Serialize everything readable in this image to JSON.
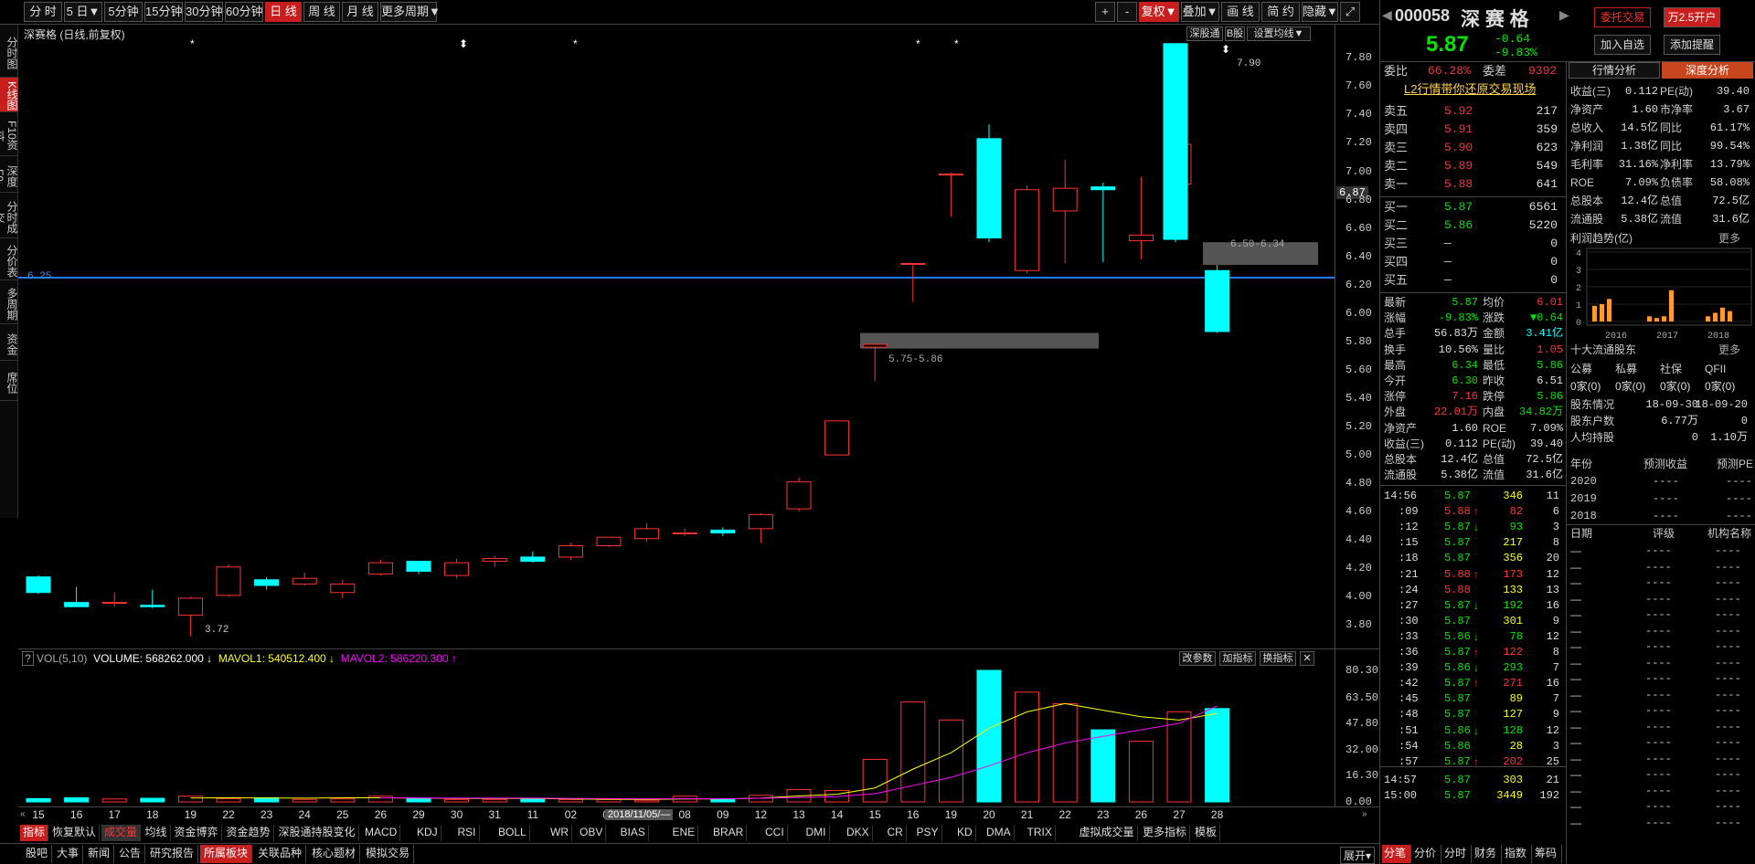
{
  "toolbar": {
    "periods": [
      "分 时",
      "5 日▼",
      "5分钟",
      "15分钟",
      "30分钟",
      "60分钟",
      "日 线",
      "周 线",
      "月 线",
      "更多周期▼"
    ],
    "active_period": "日 线",
    "right_tools": [
      "+",
      "-",
      "复权▼",
      "叠加▼",
      "画 线",
      "简 约",
      "隐藏▼",
      "⤢"
    ]
  },
  "side_tabs": [
    "分时图",
    "K线图",
    "F10资料",
    "深度F9",
    "分时成交",
    "分价表",
    "多周期",
    "资金",
    "席位"
  ],
  "chart": {
    "title": "深赛格 (日线,前复权)",
    "right_buttons": [
      "深股通",
      "B股",
      "设置均线▼"
    ],
    "y_ticks": [
      "7.80",
      "7.60",
      "7.40",
      "7.20",
      "7.00",
      "6.80",
      "6.60",
      "6.40",
      "6.20",
      "6.00",
      "5.80",
      "5.60",
      "5.40",
      "5.20",
      "5.00",
      "4.80",
      "4.60",
      "4.40",
      "4.20",
      "4.00",
      "3.80"
    ],
    "last_price_tag": "6.87",
    "hline_label": "6.25",
    "gap_labels": [
      "6.50-6.34",
      "5.75-5.86"
    ],
    "high_label": "7.90",
    "low_label": "3.72",
    "markers": [
      "*",
      "⬍",
      "*",
      "*",
      "*",
      "⬍"
    ],
    "x_labels": [
      "15",
      "16",
      "17",
      "18",
      "19",
      "22",
      "23",
      "24",
      "25",
      "26",
      "29",
      "30",
      "31",
      "11",
      "02",
      "05",
      "07",
      "08",
      "09",
      "12",
      "13",
      "14",
      "15",
      "16",
      "19",
      "20",
      "21",
      "22",
      "23",
      "26",
      "27",
      "28"
    ],
    "date_tag": "2018/11/05/—"
  },
  "vol": {
    "name": "VOL(5,10)",
    "volume": "VOLUME: 568262.000 ↓",
    "mavol1": "MAVOL1: 540512.400 ↓",
    "mavol2": "MAVOL2: 586220.300 ↑",
    "buttons": [
      "改参数",
      "加指标",
      "换指标",
      "✕"
    ],
    "y_ticks": [
      "80.30",
      "63.50",
      "47.80",
      "32.00",
      "16.30",
      "0.00"
    ]
  },
  "chart_data": {
    "type": "candlestick",
    "ylim": [
      3.7,
      7.95
    ],
    "candles": [
      {
        "x": "15",
        "o": 4.14,
        "h": 4.15,
        "l": 4.02,
        "c": 4.03
      },
      {
        "x": "16",
        "o": 3.96,
        "h": 4.07,
        "l": 3.93,
        "c": 3.93
      },
      {
        "x": "17",
        "o": 3.96,
        "h": 4.03,
        "l": 3.93,
        "c": 3.96
      },
      {
        "x": "18",
        "o": 3.94,
        "h": 4.05,
        "l": 3.92,
        "c": 3.93
      },
      {
        "x": "19",
        "o": 3.87,
        "h": 4.0,
        "l": 3.72,
        "c": 3.99
      },
      {
        "x": "22",
        "o": 4.01,
        "h": 4.23,
        "l": 4.0,
        "c": 4.21
      },
      {
        "x": "23",
        "o": 4.12,
        "h": 4.14,
        "l": 4.05,
        "c": 4.08
      },
      {
        "x": "24",
        "o": 4.09,
        "h": 4.17,
        "l": 4.08,
        "c": 4.13
      },
      {
        "x": "25",
        "o": 4.03,
        "h": 4.12,
        "l": 3.99,
        "c": 4.09
      },
      {
        "x": "26",
        "o": 4.16,
        "h": 4.26,
        "l": 4.15,
        "c": 4.24
      },
      {
        "x": "29",
        "o": 4.25,
        "h": 4.25,
        "l": 4.16,
        "c": 4.18
      },
      {
        "x": "30",
        "o": 4.15,
        "h": 4.27,
        "l": 4.13,
        "c": 4.24
      },
      {
        "x": "31",
        "o": 4.25,
        "h": 4.29,
        "l": 4.21,
        "c": 4.27
      },
      {
        "x": "11",
        "o": 4.28,
        "h": 4.32,
        "l": 4.24,
        "c": 4.25
      },
      {
        "x": "02",
        "o": 4.28,
        "h": 4.38,
        "l": 4.26,
        "c": 4.36
      },
      {
        "x": "05",
        "o": 4.36,
        "h": 4.42,
        "l": 4.35,
        "c": 4.42
      },
      {
        "x": "07",
        "o": 4.41,
        "h": 4.52,
        "l": 4.39,
        "c": 4.48
      },
      {
        "x": "08",
        "o": 4.45,
        "h": 4.48,
        "l": 4.43,
        "c": 4.45
      },
      {
        "x": "09",
        "o": 4.47,
        "h": 4.49,
        "l": 4.43,
        "c": 4.45
      },
      {
        "x": "12",
        "o": 4.48,
        "h": 4.59,
        "l": 4.38,
        "c": 4.58
      },
      {
        "x": "13",
        "o": 4.62,
        "h": 4.84,
        "l": 4.6,
        "c": 4.81
      },
      {
        "x": "14",
        "o": 5.0,
        "h": 5.24,
        "l": 5.0,
        "c": 5.24
      },
      {
        "x": "15",
        "o": 5.76,
        "h": 5.78,
        "l": 5.52,
        "c": 5.78
      },
      {
        "x": "16",
        "o": 6.35,
        "h": 6.35,
        "l": 6.08,
        "c": 6.35
      },
      {
        "x": "19",
        "o": 6.98,
        "h": 6.99,
        "l": 6.68,
        "c": 6.98
      },
      {
        "x": "20",
        "o": 7.23,
        "h": 7.33,
        "l": 6.5,
        "c": 6.53
      },
      {
        "x": "21",
        "o": 6.3,
        "h": 6.9,
        "l": 6.28,
        "c": 6.87
      },
      {
        "x": "22",
        "o": 6.72,
        "h": 7.08,
        "l": 6.35,
        "c": 6.88
      },
      {
        "x": "23",
        "o": 6.89,
        "h": 6.92,
        "l": 6.36,
        "c": 6.87
      },
      {
        "x": "26",
        "o": 6.51,
        "h": 6.96,
        "l": 6.38,
        "c": 6.55
      },
      {
        "x": "27",
        "o": 6.91,
        "h": 7.19,
        "l": 6.88,
        "c": 7.19
      },
      {
        "x": "28",
        "o": 7.9,
        "h": 7.9,
        "l": 6.5,
        "c": 6.52
      },
      {
        "x": "28",
        "o": 6.3,
        "h": 6.34,
        "l": 5.86,
        "c": 5.87
      }
    ],
    "volume": [
      2.0,
      2.5,
      1.8,
      2.2,
      3.5,
      2.0,
      2.5,
      1.5,
      1.8,
      3.5,
      2.0,
      1.5,
      1.5,
      2.0,
      1.5,
      1.5,
      1.0,
      3.5,
      1.5,
      4.0,
      7.5,
      7.0,
      26.0,
      61.0,
      50.0,
      80.3,
      67.0,
      60.0,
      44.0,
      37.0,
      55.0,
      78.0,
      57.0
    ],
    "mavol1": [
      null,
      null,
      null,
      null,
      2.4,
      2.5,
      2.4,
      2.3,
      2.5,
      2.5,
      2.3,
      2.1,
      2.1,
      2.1,
      1.8,
      1.6,
      1.5,
      1.8,
      1.8,
      2.3,
      3.6,
      4.7,
      8.5,
      20.0,
      30.0,
      45.0,
      55.0,
      60.0,
      56.0,
      52.0,
      50.0,
      55.0,
      54.0
    ],
    "mavol2": [
      null,
      null,
      null,
      null,
      null,
      null,
      null,
      null,
      null,
      2.5,
      2.4,
      2.3,
      2.3,
      2.3,
      2.1,
      2.0,
      1.9,
      2.0,
      1.9,
      2.2,
      2.7,
      3.2,
      5.0,
      10.0,
      15.0,
      22.0,
      30.0,
      36.0,
      40.0,
      44.0,
      48.0,
      55.0,
      58.6
    ]
  },
  "stock": {
    "code": "000058",
    "name": "深 赛 格",
    "price": "5.87",
    "change": "-0.64",
    "pct": "-9.83%",
    "buttons": [
      "委托交易",
      "万2.5开户",
      "加入自选",
      "添加提醒"
    ],
    "webi_label": "委比",
    "webi": "66.28%",
    "weicha_label": "委差",
    "weicha": "9392",
    "promo": "L2行情带你还原交易现场",
    "sells": [
      [
        "卖五",
        "5.92",
        "217"
      ],
      [
        "卖四",
        "5.91",
        "359"
      ],
      [
        "卖三",
        "5.90",
        "623"
      ],
      [
        "卖二",
        "5.89",
        "549"
      ],
      [
        "卖一",
        "5.88",
        "641"
      ]
    ],
    "buys": [
      [
        "买一",
        "5.87",
        "6561"
      ],
      [
        "买二",
        "5.86",
        "5220"
      ],
      [
        "买三",
        "—",
        "0"
      ],
      [
        "买四",
        "—",
        "0"
      ],
      [
        "买五",
        "—",
        "0"
      ]
    ],
    "stats": [
      [
        "最新",
        "5.87",
        "均价",
        "6.01"
      ],
      [
        "涨幅",
        "-9.83%",
        "涨跌",
        "▼0.64"
      ],
      [
        "总手",
        "56.83万",
        "金额",
        "3.41亿"
      ],
      [
        "换手",
        "10.56%",
        "量比",
        "1.05"
      ],
      [
        "最高",
        "6.34",
        "最低",
        "5.86"
      ],
      [
        "今开",
        "6.30",
        "昨收",
        "6.51"
      ],
      [
        "涨停",
        "7.16",
        "跌停",
        "5.86"
      ],
      [
        "外盘",
        "22.01万",
        "内盘",
        "34.82万"
      ],
      [
        "净资产",
        "1.60",
        "ROE",
        "7.09%"
      ],
      [
        "收益(三)",
        "0.112",
        "PE(动)",
        "39.40"
      ],
      [
        "总股本",
        "12.4亿",
        "总值",
        "72.5亿"
      ],
      [
        "流通股",
        "5.38亿",
        "流值",
        "31.6亿"
      ]
    ],
    "ticks": [
      [
        "14:56",
        "5.87",
        "346",
        "11",
        ""
      ],
      [
        ":09",
        "5.88",
        "82",
        "6",
        "↑"
      ],
      [
        ":12",
        "5.87",
        "93",
        "3",
        "↓"
      ],
      [
        ":15",
        "5.87",
        "217",
        "8",
        ""
      ],
      [
        ":18",
        "5.87",
        "356",
        "20",
        ""
      ],
      [
        ":21",
        "5.88",
        "173",
        "12",
        "↑"
      ],
      [
        ":24",
        "5.88",
        "133",
        "13",
        ""
      ],
      [
        ":27",
        "5.87",
        "192",
        "16",
        "↓"
      ],
      [
        ":30",
        "5.87",
        "301",
        "9",
        ""
      ],
      [
        ":33",
        "5.86",
        "78",
        "12",
        "↓"
      ],
      [
        ":36",
        "5.87",
        "122",
        "8",
        "↑"
      ],
      [
        ":39",
        "5.86",
        "293",
        "7",
        "↓"
      ],
      [
        ":42",
        "5.87",
        "271",
        "16",
        "↑"
      ],
      [
        ":45",
        "5.87",
        "89",
        "7",
        ""
      ],
      [
        ":48",
        "5.87",
        "127",
        "9",
        ""
      ],
      [
        ":51",
        "5.86",
        "128",
        "12",
        "↓"
      ],
      [
        ":54",
        "5.86",
        "28",
        "3",
        ""
      ],
      [
        ":57",
        "5.87",
        "202",
        "25",
        "↑"
      ],
      [
        "14:57",
        "5.87",
        "303",
        "21",
        ""
      ],
      [
        "15:00",
        "5.87",
        "3449",
        "192",
        ""
      ]
    ]
  },
  "depth": {
    "tabs": [
      "行情分析",
      "深度分析"
    ],
    "fin": [
      [
        "收益(三)",
        "0.112",
        "PE(动)",
        "39.40"
      ],
      [
        "净资产",
        "1.60",
        "市净率",
        "3.67"
      ],
      [
        "总收入",
        "14.5亿",
        "同比",
        "61.17%"
      ],
      [
        "净利润",
        "1.38亿",
        "同比",
        "99.54%"
      ],
      [
        "毛利率",
        "31.16%",
        "净利率",
        "13.79%"
      ],
      [
        "ROE",
        "7.09%",
        "负债率",
        "58.08%"
      ],
      [
        "总股本",
        "12.4亿",
        "总值",
        "72.5亿"
      ],
      [
        "流通股",
        "5.38亿",
        "流值",
        "31.6亿"
      ]
    ],
    "trend_title": "利润趋势(亿)",
    "more": "更多",
    "trend_years": [
      "2016",
      "2017",
      "2018"
    ],
    "trend_ticks": [
      "4",
      "3",
      "2",
      "1",
      "0"
    ],
    "trend_bars": [
      0.9,
      1.0,
      1.3,
      0.3,
      0.2,
      0.3,
      1.8,
      0.3,
      0.5,
      0.8,
      0.6
    ],
    "holders_title": "十大流通股东",
    "holders_more": "更多",
    "holder_types": [
      "公募",
      "私募",
      "社保",
      "QFII"
    ],
    "holder_counts": [
      "0家(0)",
      "0家(0)",
      "0家(0)",
      "0家(0)"
    ],
    "holder_info": [
      [
        "股东情况",
        "18-09-30",
        "18-09-20"
      ],
      [
        "股东户数",
        "6.77万",
        "0"
      ],
      [
        "人均持股",
        "0",
        "1.10万"
      ]
    ],
    "forecast_headers": [
      "年份",
      "预测收益",
      "预测PE"
    ],
    "forecast": [
      [
        "2020",
        "----",
        "----"
      ],
      [
        "2019",
        "----",
        "----"
      ],
      [
        "2018",
        "----",
        "----"
      ]
    ],
    "rating_headers": [
      "日期",
      "评级",
      "机构名称"
    ],
    "ratings": [
      "—",
      "—",
      "—",
      "—",
      "—",
      "—",
      "—",
      "—",
      "—",
      "—",
      "—",
      "—",
      "—",
      "—",
      "—",
      "—",
      "—",
      "—"
    ],
    "rating_dash": "----"
  },
  "indicator_tabs": [
    "指标",
    "恢复默认",
    "成交量",
    "均线",
    "资金博弈",
    "资金趋势",
    "深股通持股变化",
    "MACD",
    "KDJ",
    "RSI",
    "BOLL",
    "WR",
    "OBV",
    "BIAS",
    "ENE",
    "BRAR",
    "CCI",
    "DMI",
    "DKX",
    "CR",
    "PSY",
    "KD",
    "DMA",
    "TRIX",
    "虚拟成交量",
    "更多指标",
    "模板"
  ],
  "bottom_tabs": [
    "股吧",
    "大事",
    "新闻",
    "公告",
    "研究报告",
    "所属板块",
    "关联品种",
    "核心题材",
    "模拟交易"
  ],
  "bottom_active": "所属板块",
  "bottom_right": [
    "展开▾"
  ],
  "right_bottom_tabs": [
    "分笔",
    "分价",
    "分时",
    "财务",
    "指数",
    "筹码"
  ]
}
